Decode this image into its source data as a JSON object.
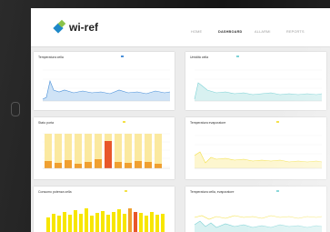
{
  "brand": {
    "name": "wi-ref"
  },
  "nav": {
    "home": "HOME",
    "dashboard": "DASHBOARD",
    "allarmi": "ALLARMI",
    "reports": "REPORTS"
  },
  "colors": {
    "blue": "#4a90d9",
    "cyan": "#7fd3d6",
    "yellow": "#f4e14a",
    "orange": "#f0a030",
    "red": "#e8572a"
  },
  "cards": [
    {
      "title": "Temperatura cella",
      "legend": ""
    },
    {
      "title": "Umidità cella",
      "legend": ""
    },
    {
      "title": "Stato porta",
      "legend": ""
    },
    {
      "title": "Temperatura evaporatore",
      "legend": ""
    },
    {
      "title": "Consumo potenza cella",
      "legend": ""
    },
    {
      "title": "Temperatura cella, evaporatore",
      "legend": ""
    }
  ]
}
